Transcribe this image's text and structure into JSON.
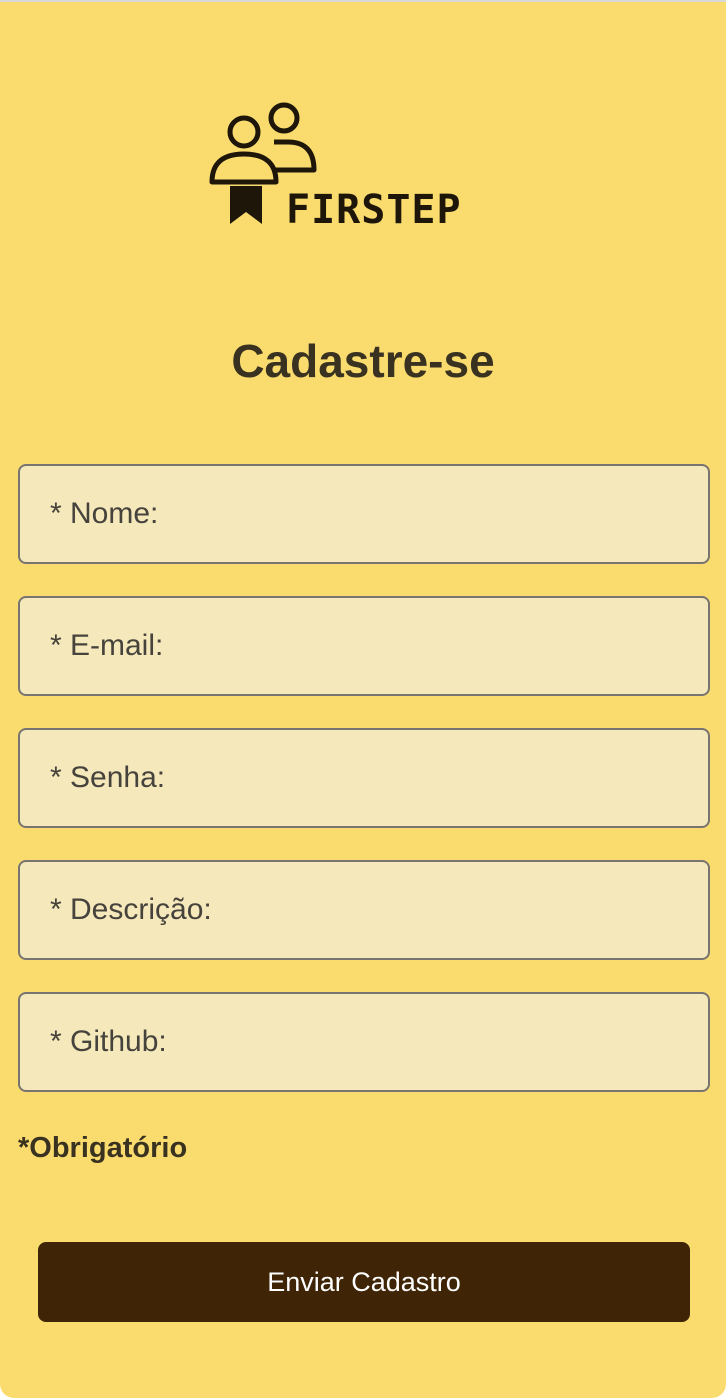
{
  "brand": {
    "logo_text": "FIRSTEP",
    "logo_icon": "people-bookmark-icon",
    "logo_color": "#1d1609"
  },
  "form": {
    "title": "Cadastre-se",
    "fields": [
      {
        "name": "nome",
        "placeholder": "* Nome:",
        "value": ""
      },
      {
        "name": "email",
        "placeholder": "* E-mail:",
        "value": ""
      },
      {
        "name": "senha",
        "placeholder": "* Senha:",
        "value": ""
      },
      {
        "name": "descricao",
        "placeholder": "* Descrição:",
        "value": ""
      },
      {
        "name": "github",
        "placeholder": "* Github:",
        "value": ""
      }
    ],
    "required_note": "*Obrigatório",
    "submit_label": "Enviar Cadastro"
  },
  "colors": {
    "background": "#fadc6e",
    "field_background": "#f5e8bb",
    "field_border": "#787470",
    "button_background": "#3f2506",
    "button_text": "#ffffff",
    "heading_text": "#3a3220"
  }
}
